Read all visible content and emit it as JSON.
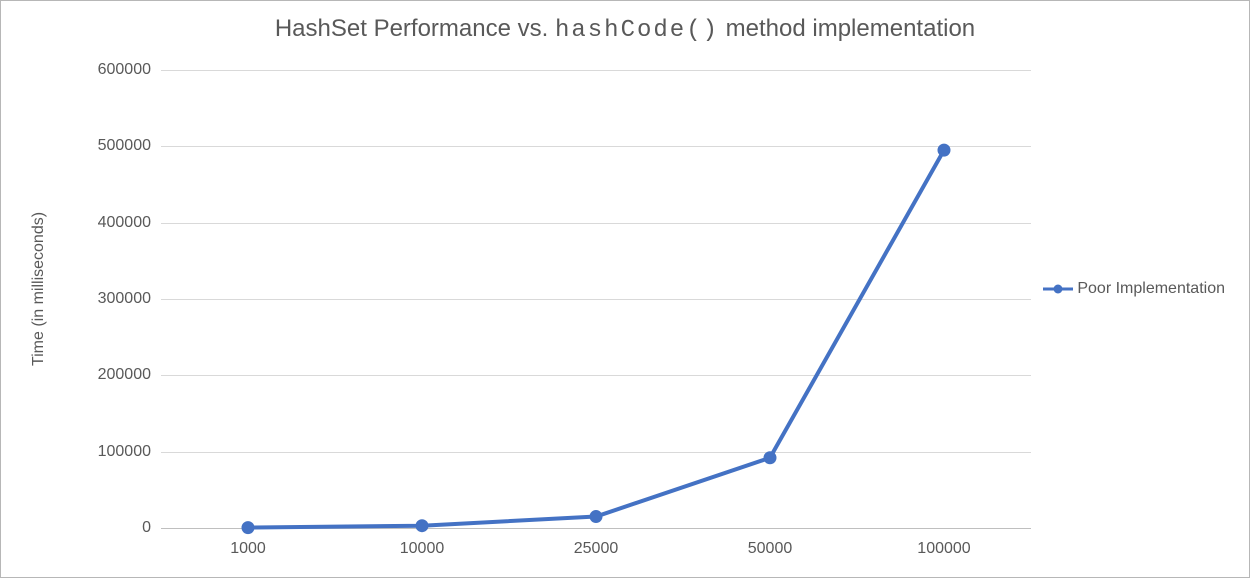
{
  "chart_data": {
    "type": "line",
    "title_parts": [
      "HashSet Performance vs. ",
      "hashCode()",
      " method implementation"
    ],
    "xlabel": "",
    "ylabel": "Time (in milliseconds)",
    "categories": [
      "1000",
      "10000",
      "25000",
      "50000",
      "100000"
    ],
    "series": [
      {
        "name": "Poor Implementation",
        "values": [
          500,
          3000,
          15000,
          92000,
          495000
        ]
      }
    ],
    "ylim": [
      0,
      600000
    ],
    "y_ticks": [
      0,
      100000,
      200000,
      300000,
      400000,
      500000,
      600000
    ],
    "grid": true,
    "legend_position": "right",
    "colors": {
      "series1": "#4472c4",
      "grid": "#d9d9d9",
      "axis": "#bfbfbf",
      "text": "#595959"
    }
  }
}
